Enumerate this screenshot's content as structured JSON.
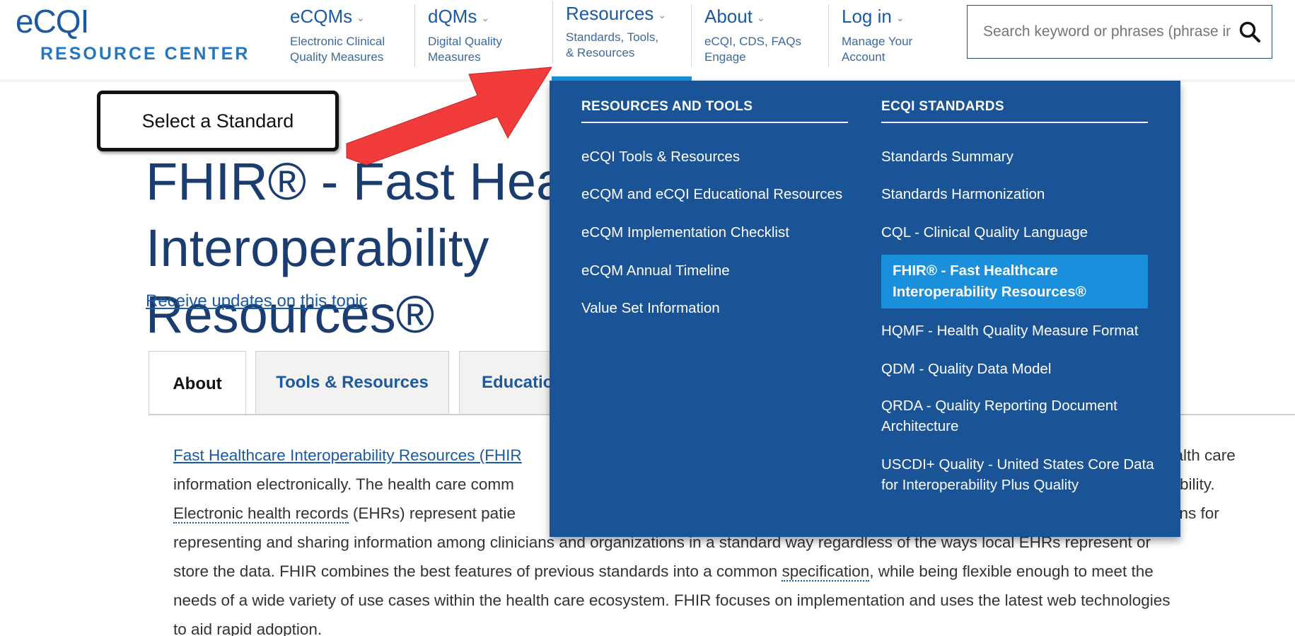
{
  "logo": {
    "top": "eCQI",
    "bottom": "RESOURCE CENTER"
  },
  "nav": [
    {
      "title": "eCQMs",
      "sub1": "Electronic Clinical",
      "sub2": "Quality Measures"
    },
    {
      "title": "dQMs",
      "sub1": "Digital Quality",
      "sub2": "Measures"
    },
    {
      "title": "Resources",
      "sub1": "Standards, Tools,",
      "sub2": "& Resources"
    },
    {
      "title": "About",
      "sub1": "eCQI, CDS, FAQs",
      "sub2": "Engage"
    },
    {
      "title": "Log in",
      "sub1": "Manage Your",
      "sub2": "Account"
    }
  ],
  "search": {
    "placeholder": "Search keyword or phrases (phrase in quotes)"
  },
  "callout": {
    "text": "Select a Standard"
  },
  "page": {
    "title_line1": "FHIR® - Fast Healthcare Interoperability",
    "title_line2": "Resources®",
    "updates_link": "Receive updates on this topic"
  },
  "tabs": [
    {
      "label": "About"
    },
    {
      "label": "Tools & Resources"
    },
    {
      "label": "Education"
    }
  ],
  "body": {
    "l1_link": "Fast Healthcare Interoperability Resources (FHIR",
    "l1_right": "ealth care",
    "l2_left": "information electronically. The health care comm",
    "l2_right": "rability.",
    "l3_link": "Electronic health records",
    "l3_left": " (EHRs) represent patie",
    "l3_right": "ans for",
    "l4": "representing and sharing information among clinicians and organizations in a standard way regardless of the ways local EHRs represent or",
    "l5_a": "store the data. FHIR combines the best features of previous standards into a common ",
    "l5_link": "specification",
    "l5_b": ", while being flexible enough to meet the",
    "l6": "needs of a wide variety of use cases within the health care ecosystem. FHIR focuses on implementation and uses the latest web technologies",
    "l7": "to aid rapid adoption."
  },
  "dropdown": {
    "col1_heading": "RESOURCES AND TOOLS",
    "col1_items": [
      "eCQI Tools & Resources",
      "eCQM and eCQI Educational Resources",
      "eCQM Implementation Checklist",
      "eCQM Annual Timeline",
      "Value Set Information"
    ],
    "col2_heading": "ECQI STANDARDS",
    "col2_items": [
      "Standards Summary",
      "Standards Harmonization",
      "CQL - Clinical Quality Language",
      "FHIR® - Fast Healthcare Interoperability Resources®",
      "HQMF - Health Quality Measure Format",
      "QDM - Quality Data Model",
      "QRDA - Quality Reporting Document Architecture",
      "USCDI+ Quality - United States Core Data for Interoperability Plus Quality"
    ]
  },
  "colors": {
    "brand": "#1b5aa0",
    "dropdown_bg": "#1a5496",
    "highlight": "#1a8fdc",
    "arrow": "#f23b3b"
  }
}
